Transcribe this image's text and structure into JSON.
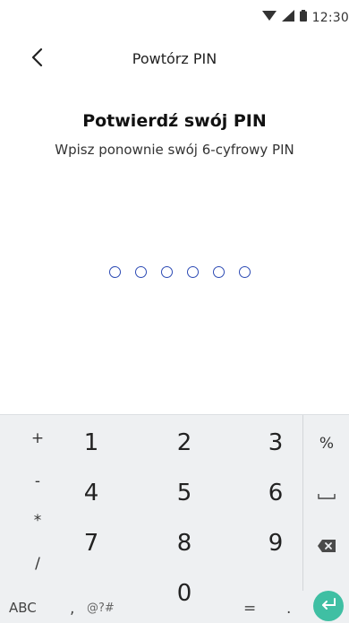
{
  "status_bar": {
    "time": "12:30"
  },
  "header": {
    "title": "Powtórz PIN"
  },
  "content": {
    "heading": "Potwierdź swój PIN",
    "subheading": "Wpisz ponownie swój 6-cyfrowy PIN",
    "pin_length": 6,
    "pin_filled": 0
  },
  "keyboard": {
    "symbols": [
      "+",
      "-",
      "*",
      "/"
    ],
    "digits": [
      "1",
      "2",
      "3",
      "4",
      "5",
      "6",
      "7",
      "8",
      "9",
      "0"
    ],
    "side": {
      "percent": "%"
    },
    "bottom": {
      "abc": "ABC",
      "comma": ",",
      "symbols": "@?#",
      "equals": "=",
      "period": "."
    }
  },
  "colors": {
    "accent": "#2d4bb4",
    "enter": "#3fbfa3",
    "keyboard_bg": "#eef0f2"
  }
}
